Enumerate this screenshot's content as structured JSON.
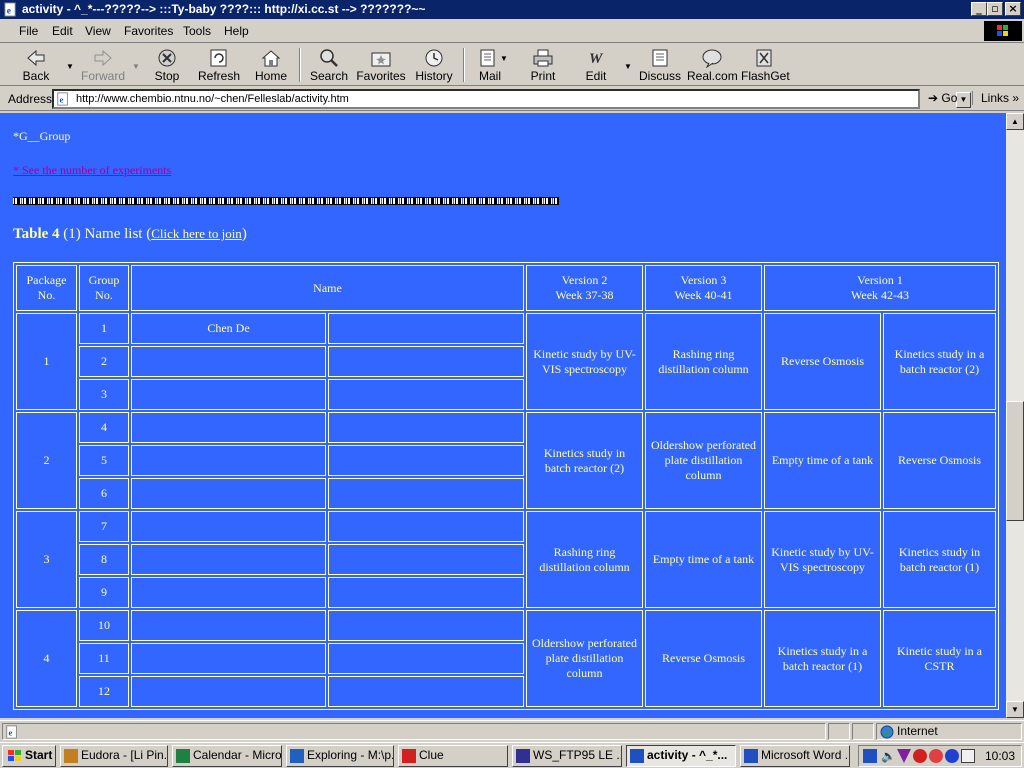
{
  "window": {
    "title": "activity - ^_*---?????-->  :::Ty-baby ????::: http://xi.cc.st --> ???????~~",
    "buttons": [
      "minimize",
      "maximize",
      "close"
    ]
  },
  "menu": [
    "File",
    "Edit",
    "View",
    "Favorites",
    "Tools",
    "Help"
  ],
  "toolbar": {
    "buttons": [
      {
        "label": "Back",
        "icon": "back-arrow-icon",
        "enabled": true
      },
      {
        "label": "Forward",
        "icon": "forward-arrow-icon",
        "enabled": false
      },
      {
        "label": "Stop",
        "icon": "stop-icon",
        "enabled": true
      },
      {
        "label": "Refresh",
        "icon": "refresh-icon",
        "enabled": true
      },
      {
        "label": "Home",
        "icon": "home-icon",
        "enabled": true
      },
      {
        "label": "Search",
        "icon": "search-icon",
        "enabled": true
      },
      {
        "label": "Favorites",
        "icon": "favorites-icon",
        "enabled": true
      },
      {
        "label": "History",
        "icon": "history-icon",
        "enabled": true
      },
      {
        "label": "Mail",
        "icon": "mail-icon",
        "enabled": true
      },
      {
        "label": "Print",
        "icon": "print-icon",
        "enabled": true
      },
      {
        "label": "Edit",
        "icon": "edit-icon",
        "enabled": true
      },
      {
        "label": "Discuss",
        "icon": "discuss-icon",
        "enabled": true
      },
      {
        "label": "Real.com",
        "icon": "real-icon",
        "enabled": true
      },
      {
        "label": "FlashGet",
        "icon": "flashget-icon",
        "enabled": true
      }
    ]
  },
  "address": {
    "label": "Address",
    "url": "http://www.chembio.ntnu.no/~chen/Felleslab/activity.htm",
    "go": "Go",
    "links": "Links"
  },
  "page": {
    "group_label": "*G__Group",
    "experiments_link": "* See the number of experiments",
    "table_title_bold": "Table 4",
    "table_title_text": " (1) Name list (",
    "join_link": "Click here to join",
    "table_title_end": ")",
    "header": {
      "package": "Package No.",
      "group": "Group No.",
      "name": "Name",
      "v2": "Version 2",
      "v2_week": "Week 37-38",
      "v3": "Version 3",
      "v3_week": "Week 40-41",
      "v1": "Version 1",
      "v1_week": "Week 42-43"
    },
    "packages": [
      {
        "no": "1",
        "groups": [
          "1",
          "2",
          "3"
        ],
        "names": [
          "Chen De",
          "",
          ""
        ],
        "v2": "Kinetic study by UV-VIS spectroscopy",
        "v3": "Rashing ring distillation column",
        "v1a": "Reverse Osmosis",
        "v1b": "Kinetics study in a batch reactor (2)"
      },
      {
        "no": "2",
        "groups": [
          "4",
          "5",
          "6"
        ],
        "names": [
          "",
          "",
          ""
        ],
        "v2": "Kinetics study in batch reactor (2)",
        "v3": "Oldershow perforated plate distillation column",
        "v1a": "Empty time of a tank",
        "v1b": "Reverse Osmosis"
      },
      {
        "no": "3",
        "groups": [
          "7",
          "8",
          "9"
        ],
        "names": [
          "",
          "",
          ""
        ],
        "v2": "Rashing ring distillation column",
        "v3": "Empty time of a tank",
        "v1a": "Kinetic study by UV-VIS spectroscopy",
        "v1b": "Kinetics study in batch reactor (1)"
      },
      {
        "no": "4",
        "groups": [
          "10",
          "11",
          "12"
        ],
        "names": [
          "",
          "",
          ""
        ],
        "v2": "Oldershow perforated plate distillation column",
        "v3": "Reverse Osmosis",
        "v1a": "Kinetics study in a batch reactor (1)",
        "v1b": "Kinetic study in a CSTR"
      }
    ]
  },
  "status": {
    "zone": "Internet"
  },
  "taskbar": {
    "start": "Start",
    "tasks": [
      "Eudora - [Li Pin...",
      "Calendar - Micro...",
      "Exploring - M:\\p...",
      "Clue",
      "WS_FTP95 LE ...",
      "activity - ^_*...",
      "Microsoft Word ..."
    ],
    "active_index": 5,
    "clock": "10:03"
  },
  "colors": {
    "page_bg": "#3366ff",
    "page_text": "#ffff99",
    "visited_link": "#a000a0",
    "title_bar": "#0a246a"
  }
}
